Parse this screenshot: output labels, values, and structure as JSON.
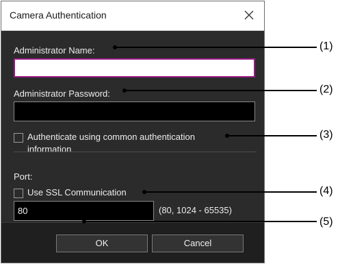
{
  "dialog": {
    "title": "Camera Authentication",
    "close_icon": "close-x-icon"
  },
  "fields": {
    "admin_name": {
      "label": "Administrator Name:",
      "value": "",
      "placeholder": ""
    },
    "admin_password": {
      "label": "Administrator Password:",
      "value": "",
      "placeholder": ""
    },
    "common_auth": {
      "label_line1": "Authenticate using common authentication",
      "label_line2": "information",
      "checked": false
    },
    "port": {
      "label": "Port:",
      "ssl_label": "Use SSL Communication",
      "ssl_checked": false,
      "value": "80",
      "range_hint": "(80, 1024 - 65535)"
    }
  },
  "buttons": {
    "ok": "OK",
    "cancel": "Cancel"
  },
  "callouts": [
    "(1)",
    "(2)",
    "(3)",
    "(4)",
    "(5)"
  ],
  "colors": {
    "dialog_bg": "#2b2b2b",
    "focus_border": "#9a1a86",
    "footer_bg": "#1f1f1f"
  }
}
